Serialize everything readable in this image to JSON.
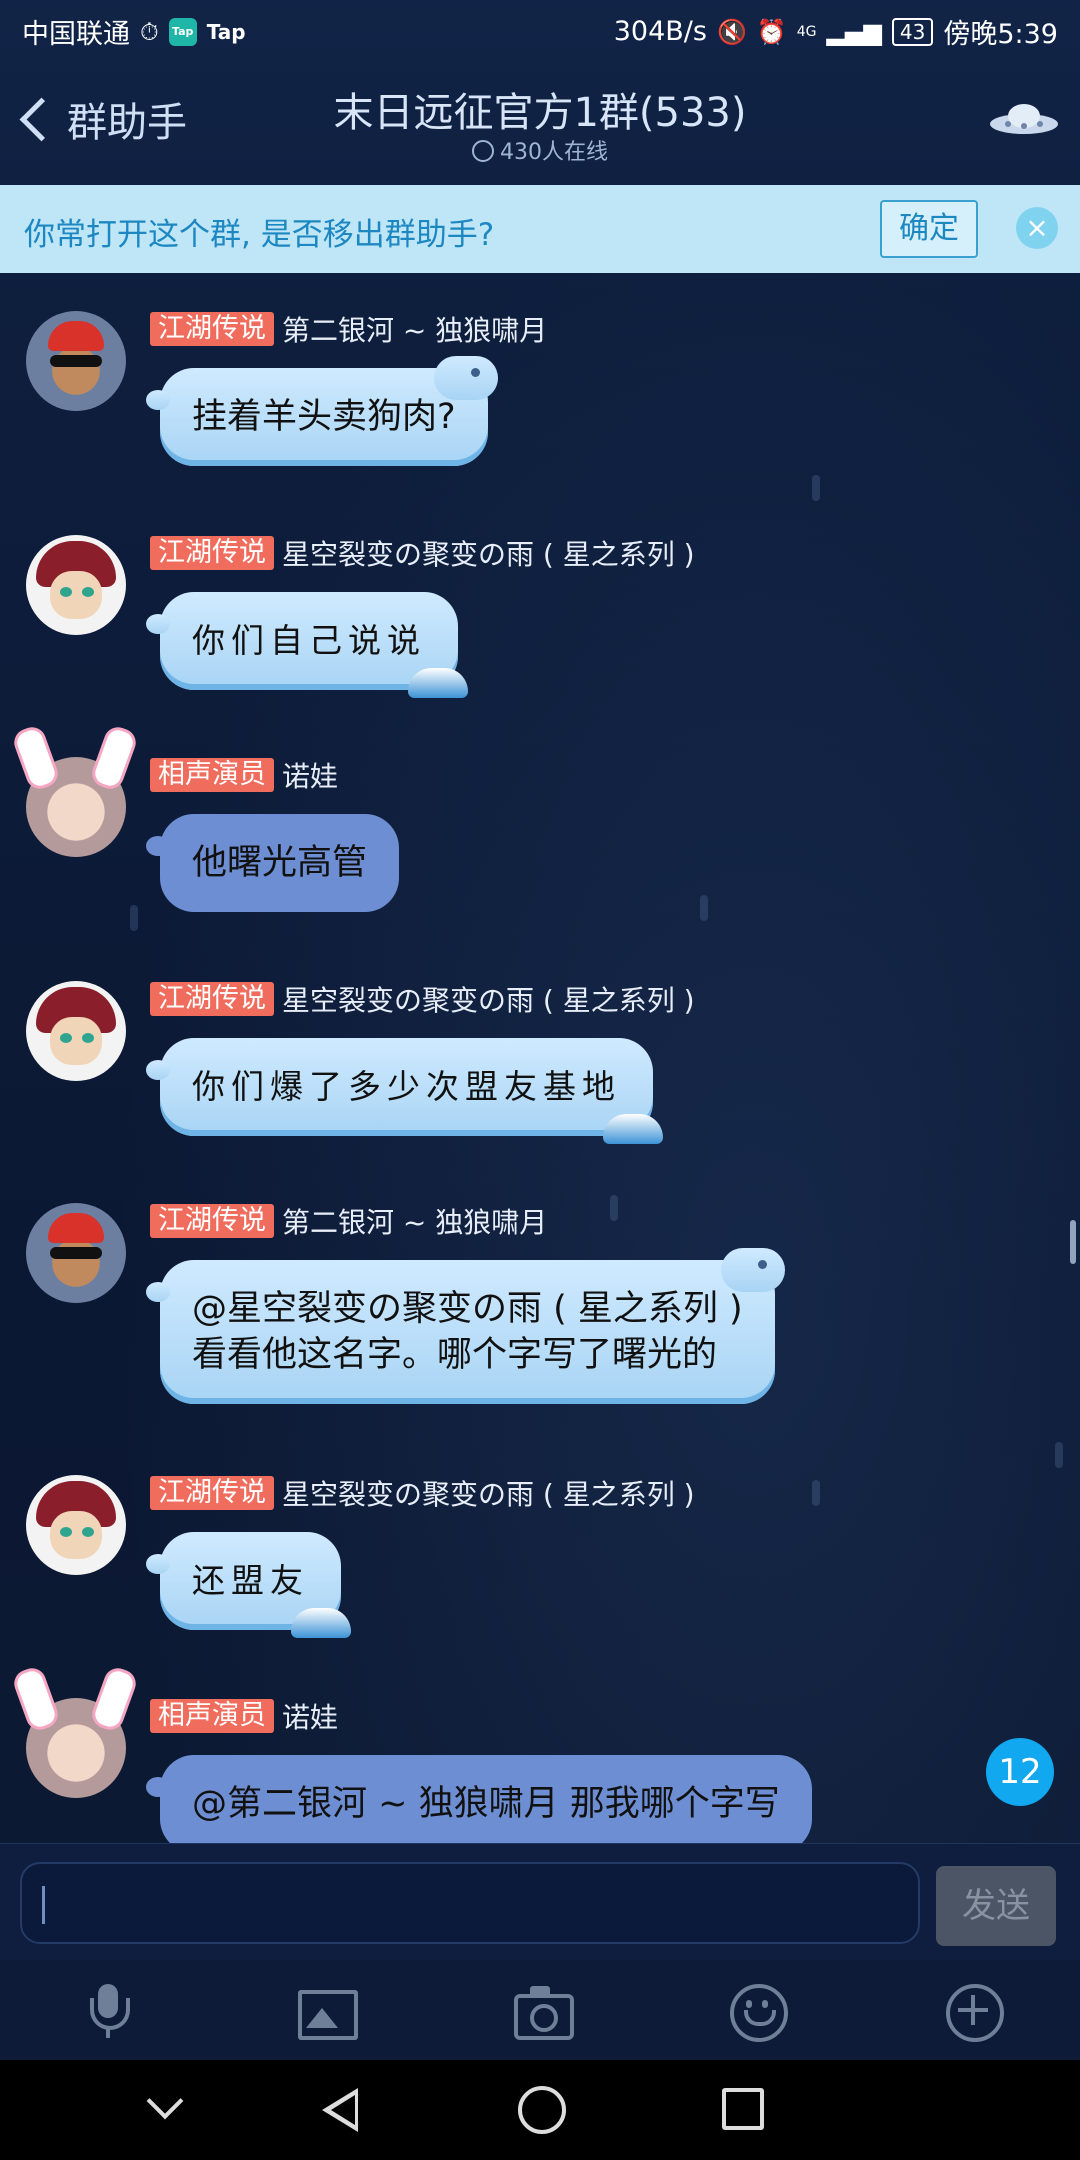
{
  "status_bar": {
    "carrier": "中国联通",
    "tap_label": "Tap",
    "net_speed": "304B/s",
    "network": "4G",
    "battery": "43",
    "time": "傍晚5:39"
  },
  "header": {
    "back_label": "群助手",
    "title": "末日远征官方1群(533)",
    "online": "430人在线"
  },
  "banner": {
    "text": "你常打开这个群, 是否移出群助手?",
    "confirm_label": "确定",
    "close_icon": "×"
  },
  "messages": [
    {
      "badge": "江湖传说",
      "name": "第二银河 ~ 独狼啸月",
      "text": "挂着羊头卖狗肉?"
    },
    {
      "badge": "江湖传说",
      "name": "星空裂变の聚变の雨 ( 星之系列 )",
      "text": "你们自己说说"
    },
    {
      "badge": "相声演员",
      "name": "诺娃",
      "text": "他曙光高管"
    },
    {
      "badge": "江湖传说",
      "name": "星空裂变の聚变の雨 ( 星之系列 )",
      "text": "你们爆了多少次盟友基地"
    },
    {
      "badge": "江湖传说",
      "name": "第二银河 ~ 独狼啸月",
      "text_line1": "@星空裂变の聚变の雨 ( 星之系列 )",
      "text_line2": "看看他这名字。哪个字写了曙光的"
    },
    {
      "badge": "江湖传说",
      "name": "星空裂变の聚变の雨 ( 星之系列 )",
      "text": "还盟友"
    },
    {
      "badge": "相声演员",
      "name": "诺娃",
      "text": "@第二银河 ~ 独狼啸月 那我哪个字写"
    }
  ],
  "unread_count": "12",
  "input": {
    "value": "",
    "send_label": "发送"
  },
  "toolbar_icons": [
    "mic-icon",
    "image-icon",
    "camera-icon",
    "emoji-icon",
    "plus-icon"
  ],
  "colors": {
    "badge": "#f06d5e",
    "bubble": "#a8d4f4",
    "banner": "#bfe6f7",
    "unread": "#12a8ef"
  }
}
